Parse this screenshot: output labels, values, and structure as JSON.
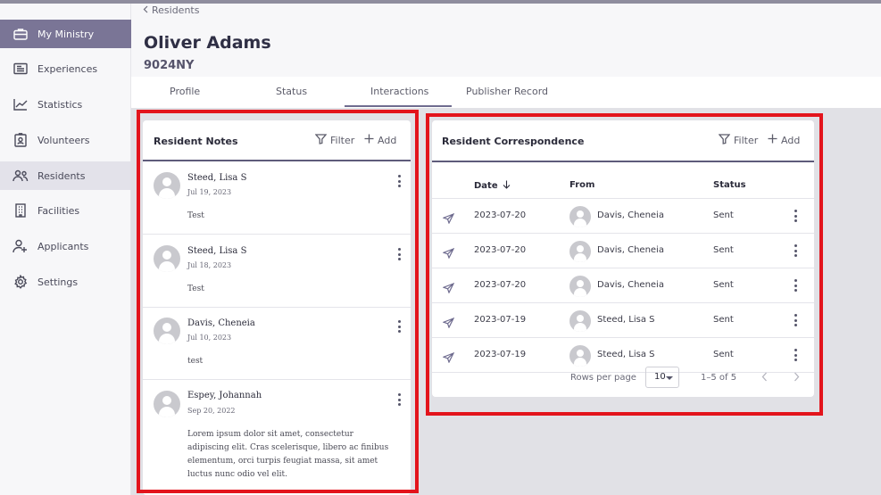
{
  "sidebar": {
    "items": [
      {
        "label": "My Ministry",
        "icon": "briefcase-icon"
      },
      {
        "label": "Experiences",
        "icon": "newspaper-icon"
      },
      {
        "label": "Statistics",
        "icon": "chart-line-icon"
      },
      {
        "label": "Volunteers",
        "icon": "id-badge-icon"
      },
      {
        "label": "Residents",
        "icon": "people-icon"
      },
      {
        "label": "Facilities",
        "icon": "building-icon"
      },
      {
        "label": "Applicants",
        "icon": "person-add-icon"
      },
      {
        "label": "Settings",
        "icon": "gear-icon"
      }
    ]
  },
  "header": {
    "breadcrumb": "Residents",
    "title": "Oliver Adams",
    "subtitle": "9024NY"
  },
  "tabs": [
    {
      "label": "Profile"
    },
    {
      "label": "Status"
    },
    {
      "label": "Interactions"
    },
    {
      "label": "Publisher Record"
    }
  ],
  "notes": {
    "title": "Resident Notes",
    "filter_label": "Filter",
    "add_label": "Add",
    "items": [
      {
        "name": "Steed, Lisa S",
        "date": "Jul 19, 2023",
        "body": "Test"
      },
      {
        "name": "Steed, Lisa S",
        "date": "Jul 18, 2023",
        "body": "Test"
      },
      {
        "name": "Davis, Cheneia",
        "date": "Jul 10, 2023",
        "body": "test"
      },
      {
        "name": "Espey, Johannah",
        "date": "Sep 20, 2022",
        "body": "Lorem ipsum dolor sit amet, consectetur adipiscing elit. Cras scelerisque, libero ac finibus elementum, orci turpis feugiat massa, sit amet luctus nunc odio vel elit."
      }
    ]
  },
  "correspondence": {
    "title": "Resident Correspondence",
    "filter_label": "Filter",
    "add_label": "Add",
    "columns": {
      "date": "Date",
      "from": "From",
      "status": "Status"
    },
    "rows": [
      {
        "date": "2023-07-20",
        "from": "Davis, Cheneia",
        "status": "Sent"
      },
      {
        "date": "2023-07-20",
        "from": "Davis, Cheneia",
        "status": "Sent"
      },
      {
        "date": "2023-07-20",
        "from": "Davis, Cheneia",
        "status": "Sent"
      },
      {
        "date": "2023-07-19",
        "from": "Steed, Lisa S",
        "status": "Sent"
      },
      {
        "date": "2023-07-19",
        "from": "Steed, Lisa S",
        "status": "Sent"
      }
    ],
    "pagination": {
      "rows_per_page_label": "Rows per page",
      "rows_per_page_value": "10",
      "range": "1–5 of 5"
    }
  },
  "colors": {
    "accent": "#7a7596",
    "highlight": "#e3141c",
    "divider": "#5e5b7a"
  }
}
